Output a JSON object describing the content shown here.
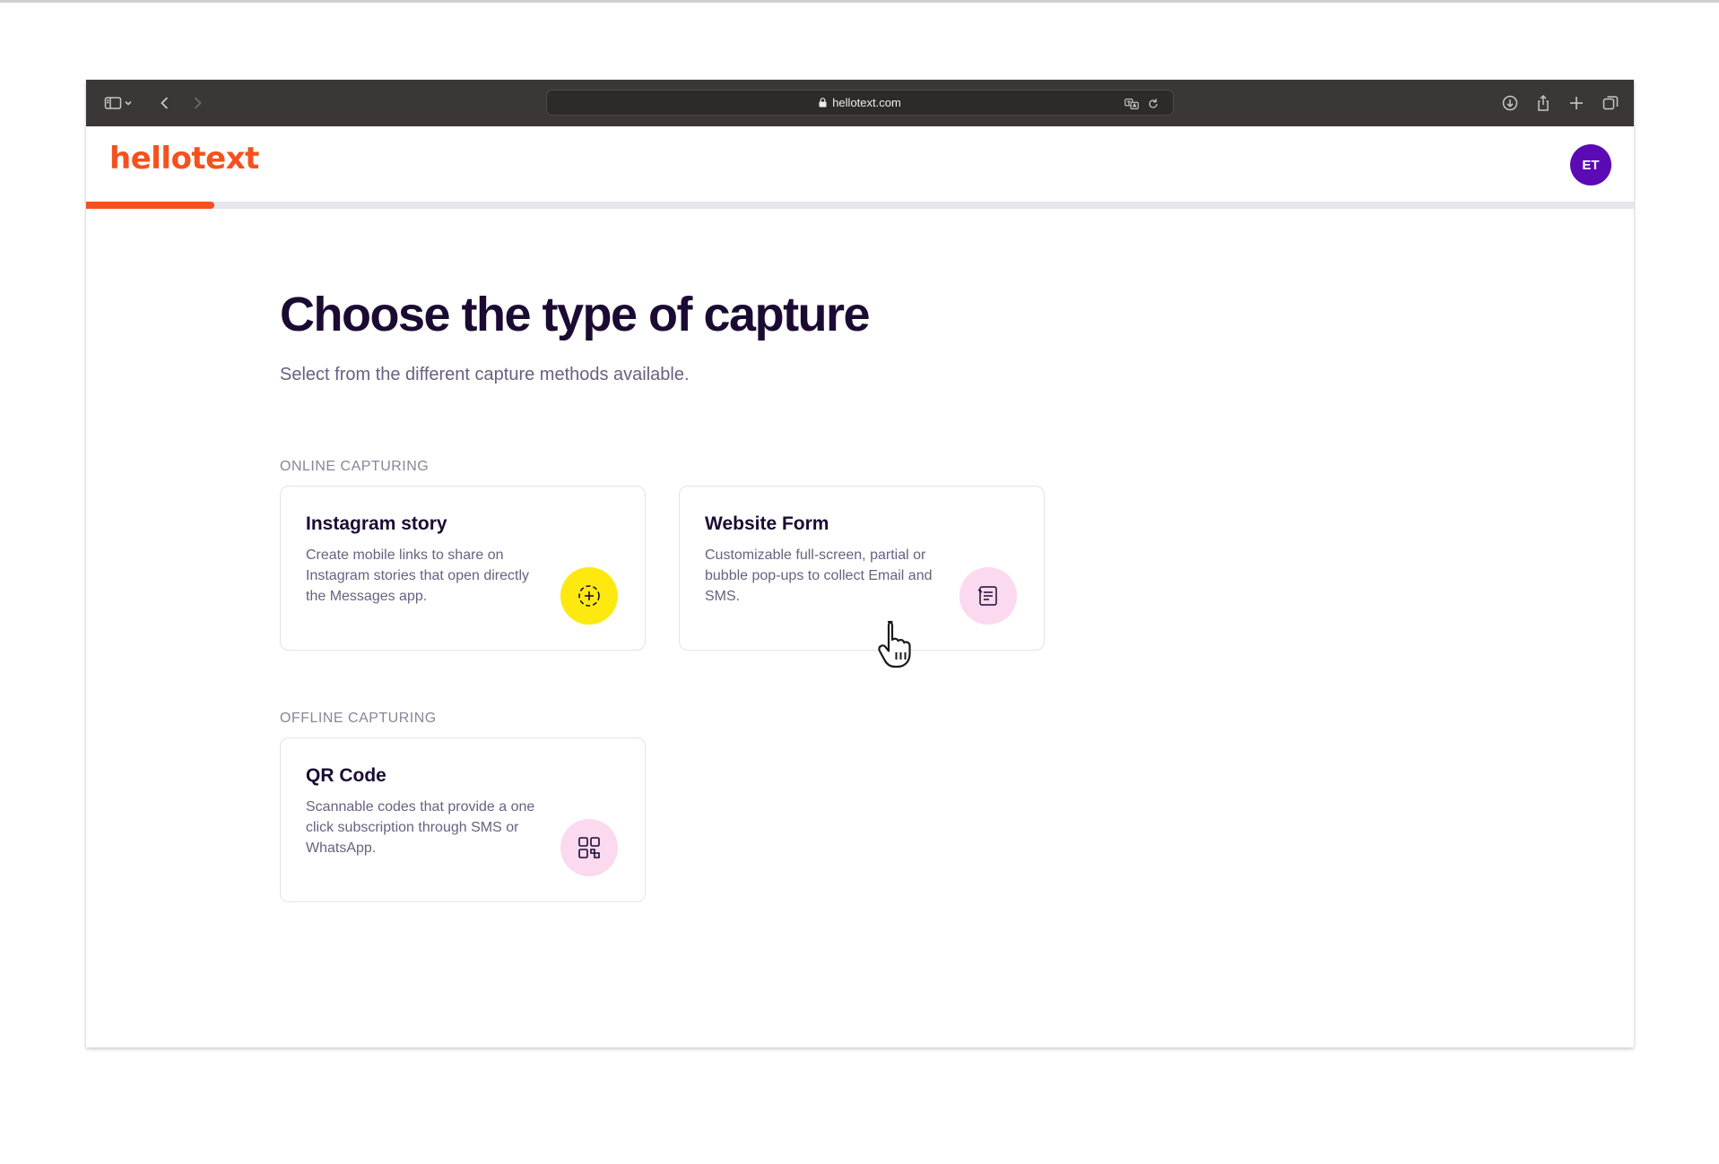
{
  "browser": {
    "url": "hellotext.com"
  },
  "app": {
    "logo_text": "hellotext",
    "avatar_initials": "ET",
    "progress": 0.083,
    "brand_color": "#f4511e",
    "avatar_color": "#5b0ab6"
  },
  "page": {
    "title": "Choose the type of capture",
    "subtitle": "Select from the different capture methods available."
  },
  "sections": [
    {
      "label": "ONLINE CAPTURING",
      "cards": [
        {
          "title": "Instagram story",
          "description": "Create mobile links to share on Instagram stories that open directly the Messages app.",
          "icon": "dashed-circle-plus-icon",
          "icon_bg": "#fde910"
        },
        {
          "title": "Website Form",
          "description": "Customizable full-screen, partial or bubble pop-ups to collect Email and SMS.",
          "icon": "form-document-icon",
          "icon_bg": "#fbd9ef"
        }
      ]
    },
    {
      "label": "OFFLINE CAPTURING",
      "cards": [
        {
          "title": "QR Code",
          "description": "Scannable codes that provide a one click subscription through SMS or WhatsApp.",
          "icon": "qr-code-icon",
          "icon_bg": "#fbd9ef"
        }
      ]
    }
  ]
}
